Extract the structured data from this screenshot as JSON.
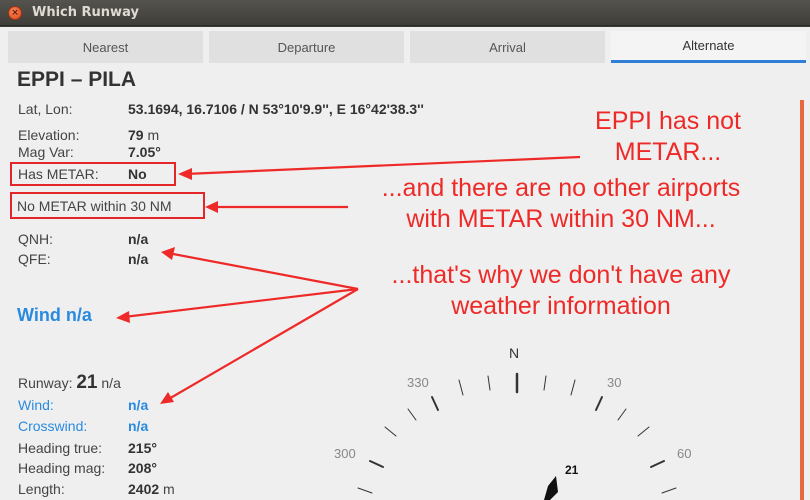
{
  "window": {
    "title": "Which Runway"
  },
  "tabs": [
    {
      "label": "Nearest"
    },
    {
      "label": "Departure"
    },
    {
      "label": "Arrival"
    },
    {
      "label": "Alternate"
    }
  ],
  "airport": {
    "name": "EPPI – PILA",
    "latlon_label": "Lat, Lon:",
    "latlon_value": "53.1694, 16.7106  /  N 53°10'9.9'', E 16°42'38.3''",
    "elevation_label": "Elevation:",
    "elevation_value": "79",
    "elevation_unit": "m",
    "magvar_label": "Mag Var:",
    "magvar_value": "7.05°",
    "has_metar_label": "Has METAR:",
    "has_metar_value": "No",
    "no_metar_text": "No METAR within 30 NM",
    "qnh_label": "QNH:",
    "qnh_value": "n/a",
    "qfe_label": "QFE:",
    "qfe_value": "n/a",
    "wind_heading": "Wind n/a"
  },
  "runway": {
    "label": "Runway:",
    "number": "21",
    "number_suffix": "n/a",
    "wind_label": "Wind:",
    "wind_value": "n/a",
    "crosswind_label": "Crosswind:",
    "crosswind_value": "n/a",
    "heading_true_label": "Heading true:",
    "heading_true_value": "215°",
    "heading_mag_label": "Heading mag:",
    "heading_mag_value": "208°",
    "length_label": "Length:",
    "length_value": "2402",
    "length_unit": "m"
  },
  "compass": {
    "north": "N",
    "labels": [
      "330",
      "30",
      "300",
      "60"
    ],
    "runway_marker": "21"
  },
  "annotations": {
    "a1_line1": "EPPI has not",
    "a1_line2": "METAR...",
    "a2_line1": "...and there are no other airports",
    "a2_line2": "with METAR within 30 NM...",
    "a3_line1": "...that's why we don't have any",
    "a3_line2": "weather information"
  },
  "colors": {
    "accent": "#2f7fd7",
    "annotation": "#ee2a28",
    "wind_blue": "#2a8ae0"
  }
}
